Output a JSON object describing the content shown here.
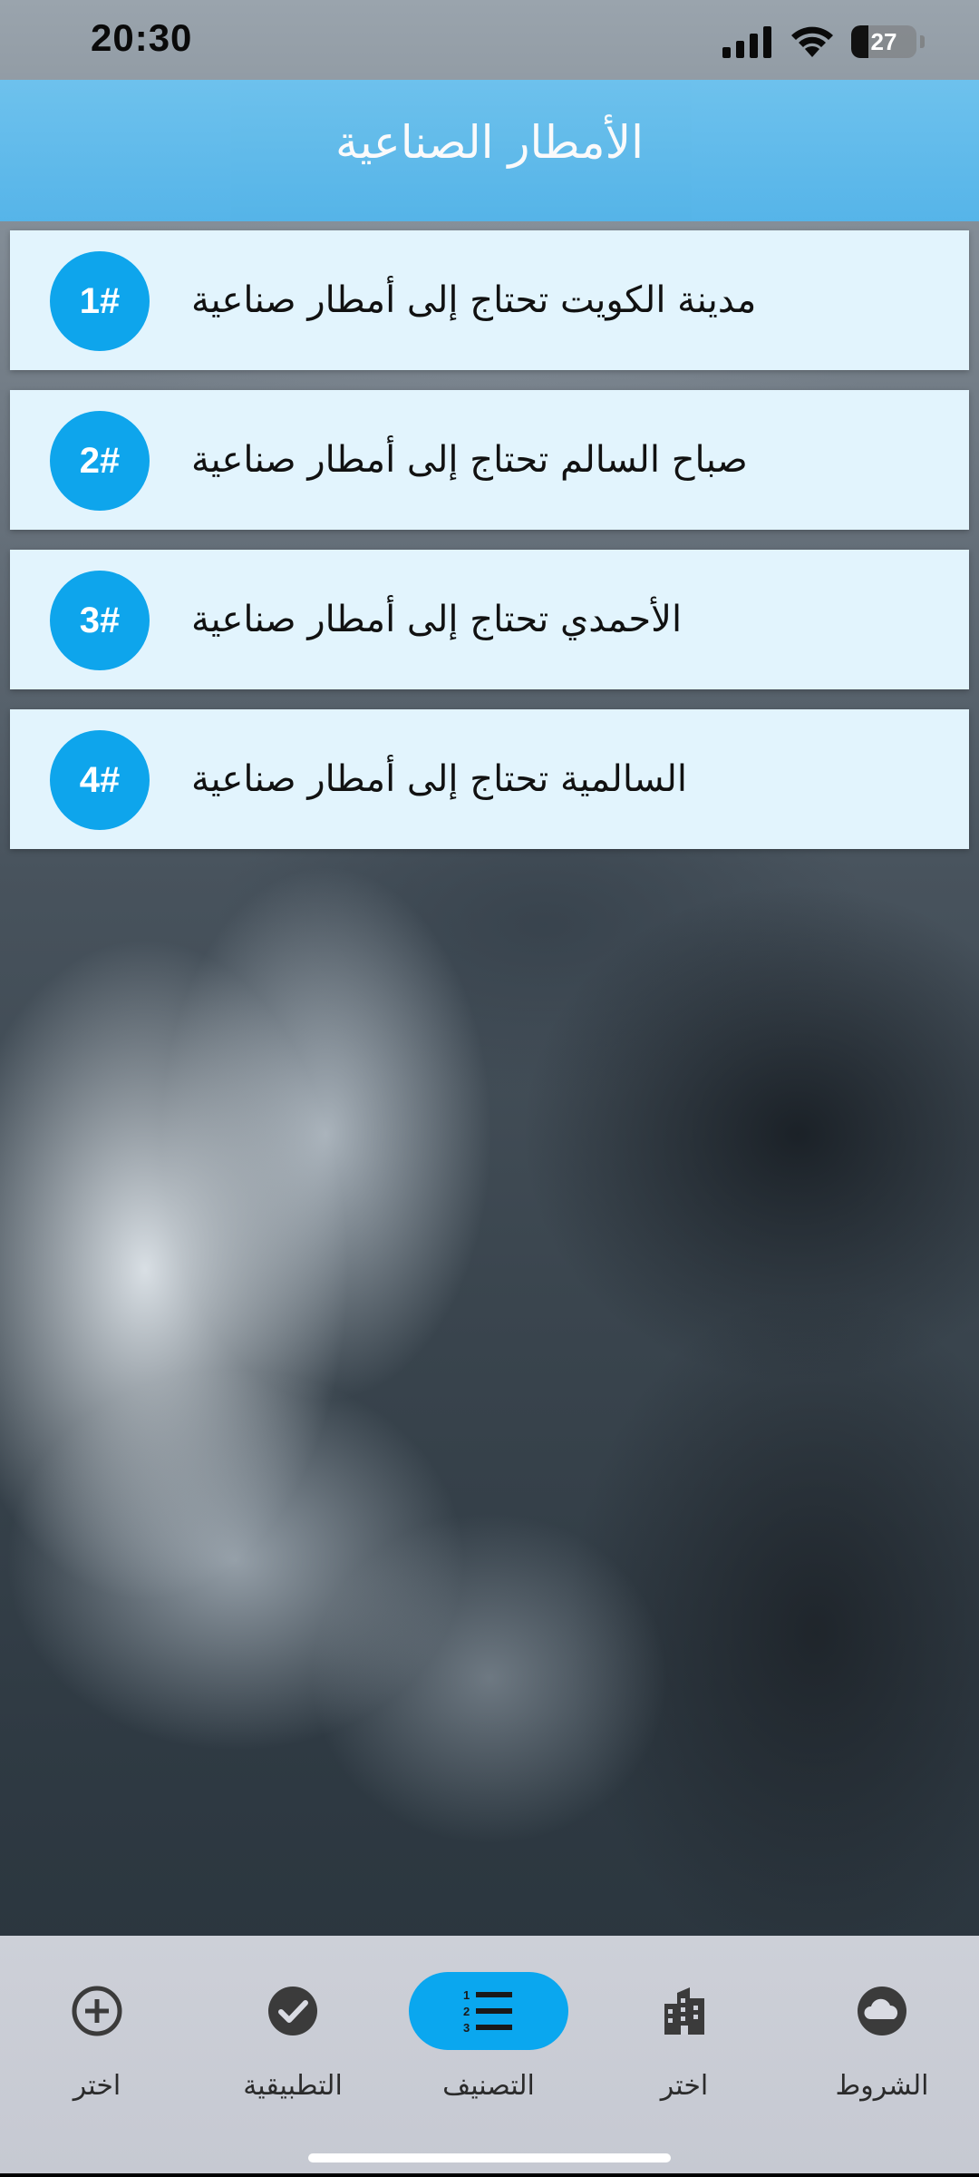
{
  "status_bar": {
    "time": "20:30",
    "battery": "27",
    "battery_level": 0.27
  },
  "header": {
    "title": "الأمطار الصناعية"
  },
  "list": {
    "items": [
      {
        "badge": "1#",
        "text": "مدينة الكويت تحتاج إلى أمطار صناعية"
      },
      {
        "badge": "2#",
        "text": "صباح السالم تحتاج إلى أمطار صناعية"
      },
      {
        "badge": "3#",
        "text": "الأحمدي تحتاج إلى أمطار صناعية"
      },
      {
        "badge": "4#",
        "text": "السالمية تحتاج إلى أمطار صناعية"
      }
    ]
  },
  "bottom_nav": {
    "items": [
      {
        "label": "اختر",
        "icon": "add-circle-icon"
      },
      {
        "label": "التطبيقية",
        "icon": "check-circle-icon"
      },
      {
        "label": "التصنيف",
        "icon": "ordered-list-icon",
        "active": true
      },
      {
        "label": "اختر",
        "icon": "buildings-icon"
      },
      {
        "label": "الشروط",
        "icon": "cloud-circle-icon"
      }
    ]
  },
  "colors": {
    "header": "#54b6ec",
    "badge": "#0ea5ec",
    "list_item_bg": "#e2f4fd",
    "active_tab": "#0aa7ef",
    "nav_bg": "#c6c9d2"
  }
}
